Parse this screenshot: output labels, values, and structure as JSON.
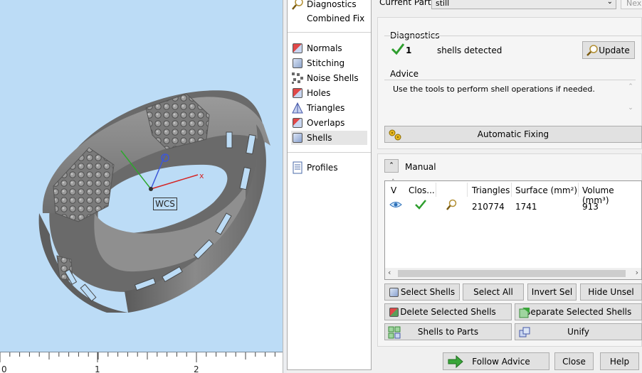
{
  "viewport": {
    "wcs_label": "WCS",
    "axis_x_label": "x",
    "ruler_numbers": [
      "0",
      "1",
      "2"
    ]
  },
  "tree": {
    "items": [
      {
        "label": "Diagnostics",
        "icon": "magnifier-icon"
      },
      {
        "label": "Combined Fix",
        "icon": "combined-fix-icon"
      },
      {
        "label": "Normals",
        "icon": "normals-cube-icon"
      },
      {
        "label": "Stitching",
        "icon": "stitching-cube-icon"
      },
      {
        "label": "Noise Shells",
        "icon": "noise-shells-icon"
      },
      {
        "label": "Holes",
        "icon": "holes-cube-icon"
      },
      {
        "label": "Triangles",
        "icon": "triangles-icon"
      },
      {
        "label": "Overlaps",
        "icon": "overlaps-cube-icon"
      },
      {
        "label": "Shells",
        "icon": "shells-cube-icon"
      },
      {
        "label": "Profiles",
        "icon": "profiles-document-icon"
      }
    ],
    "selected": "Shells"
  },
  "top": {
    "combo_label": "Current Part:",
    "combo_value": "still",
    "next_label": "Nex"
  },
  "diagnostics": {
    "title": "Diagnostics",
    "count": "1",
    "count_text": "shells detected",
    "update_label": "Update"
  },
  "advice": {
    "title": "Advice",
    "text": "Use the tools to perform shell operations if needed.",
    "auto_fix_label": "Automatic Fixing"
  },
  "manual": {
    "title": "Manual",
    "columns": [
      "V",
      "Clos...",
      "",
      "Triangles",
      "Surface (mm²)",
      "Volume (mm³)"
    ],
    "row": {
      "triangles": "210774",
      "surface": "1741",
      "volume": "913"
    }
  },
  "buttons": {
    "select_shells": "Select Shells",
    "select_all": "Select All",
    "invert_sel": "Invert Sel",
    "hide_unsel": "Hide Unsel",
    "delete_selected": "Delete Selected Shells",
    "separate_selected": "Separate Selected Shells",
    "shells_to_parts": "Shells to Parts",
    "unify": "Unify",
    "follow_advice": "Follow Advice",
    "close": "Close",
    "help": "Help"
  },
  "colors": {
    "viewport_bg": "#bcdcf6",
    "check_green": "#2e9e2e",
    "ring_gray": "#7d7d7d",
    "follow_arrow": "#3aa63a"
  }
}
